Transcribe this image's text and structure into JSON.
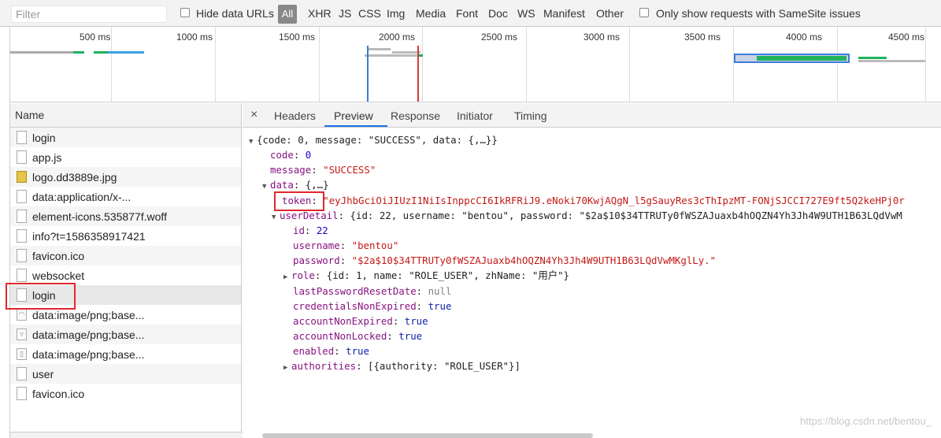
{
  "filterbar": {
    "filter_placeholder": "Filter",
    "hide_data_urls": "Hide data URLs",
    "types": [
      "All",
      "XHR",
      "JS",
      "CSS",
      "Img",
      "Media",
      "Font",
      "Doc",
      "WS",
      "Manifest",
      "Other"
    ],
    "samesite": "Only show requests with SameSite issues"
  },
  "overview": {
    "ticks": [
      "500 ms",
      "1000 ms",
      "1500 ms",
      "2000 ms",
      "2500 ms",
      "3000 ms",
      "3500 ms",
      "4000 ms",
      "4500 ms"
    ]
  },
  "namepane": {
    "header": "Name",
    "requests": [
      {
        "name": "login",
        "icon": "doc"
      },
      {
        "name": "app.js",
        "icon": "doc"
      },
      {
        "name": "logo.dd3889e.jpg",
        "icon": "img"
      },
      {
        "name": "data:application/x-...",
        "icon": "doc"
      },
      {
        "name": "element-icons.535877f.woff",
        "icon": "doc"
      },
      {
        "name": "info?t=1586358917421",
        "icon": "doc"
      },
      {
        "name": "favicon.ico",
        "icon": "doc"
      },
      {
        "name": "websocket",
        "icon": "doc"
      },
      {
        "name": "login",
        "icon": "doc"
      },
      {
        "name": "data:image/png;base...",
        "icon": "small"
      },
      {
        "name": "data:image/png;base...",
        "icon": "small"
      },
      {
        "name": "data:image/png;base...",
        "icon": "small"
      },
      {
        "name": "user",
        "icon": "doc"
      },
      {
        "name": "favicon.ico",
        "icon": "doc"
      }
    ]
  },
  "detail": {
    "close": "×",
    "tabs": [
      "Headers",
      "Preview",
      "Response",
      "Initiator",
      "Timing"
    ],
    "active_tab": "Preview",
    "json": {
      "root_summary": "{code: 0, message: \"SUCCESS\", data: {,…}}",
      "code_key": "code",
      "code_val": "0",
      "message_key": "message",
      "message_val": "\"SUCCESS\"",
      "data_key": "data",
      "data_summary": "{,…}",
      "token_key": "token",
      "token_val": "\"eyJhbGciOiJIUzI1NiIsInppcCI6IkRFRiJ9.eNoki70KwjAQgN_l5gSauyRes3cThIpzMT-FONjSJCCI727E9ft5Q2keHPj0r",
      "userDetail_key": "userDetail",
      "userDetail_summary": "{id: 22, username: \"bentou\", password: \"$2a$10$34TTRUTy0fWSZAJuaxb4hOQZN4Yh3Jh4W9UTH1B63LQdVwM",
      "id_key": "id",
      "id_val": "22",
      "username_key": "username",
      "username_val": "\"bentou\"",
      "password_key": "password",
      "password_val": "\"$2a$10$34TTRUTy0fWSZAJuaxb4hOQZN4Yh3Jh4W9UTH1B63LQdVwMKglLy.\"",
      "role_key": "role",
      "role_summary": "{id: 1, name: \"ROLE_USER\", zhName: \"用户\"}",
      "lprd_key": "lastPasswordResetDate",
      "lprd_val": "null",
      "cne_key": "credentialsNonExpired",
      "cne_val": "true",
      "ane_key": "accountNonExpired",
      "ane_val": "true",
      "anl_key": "accountNonLocked",
      "anl_val": "true",
      "enabled_key": "enabled",
      "enabled_val": "true",
      "authorities_key": "authorities",
      "authorities_summary": "[{authority: \"ROLE_USER\"}]"
    }
  },
  "watermark": "https://blog.csdn.net/bentou_",
  "colors": {
    "highlight_red": "#e0282e",
    "active_tab_blue": "#1a73e8",
    "json_key": "#881280",
    "json_string": "#c41a16",
    "json_number": "#1c00cf"
  }
}
